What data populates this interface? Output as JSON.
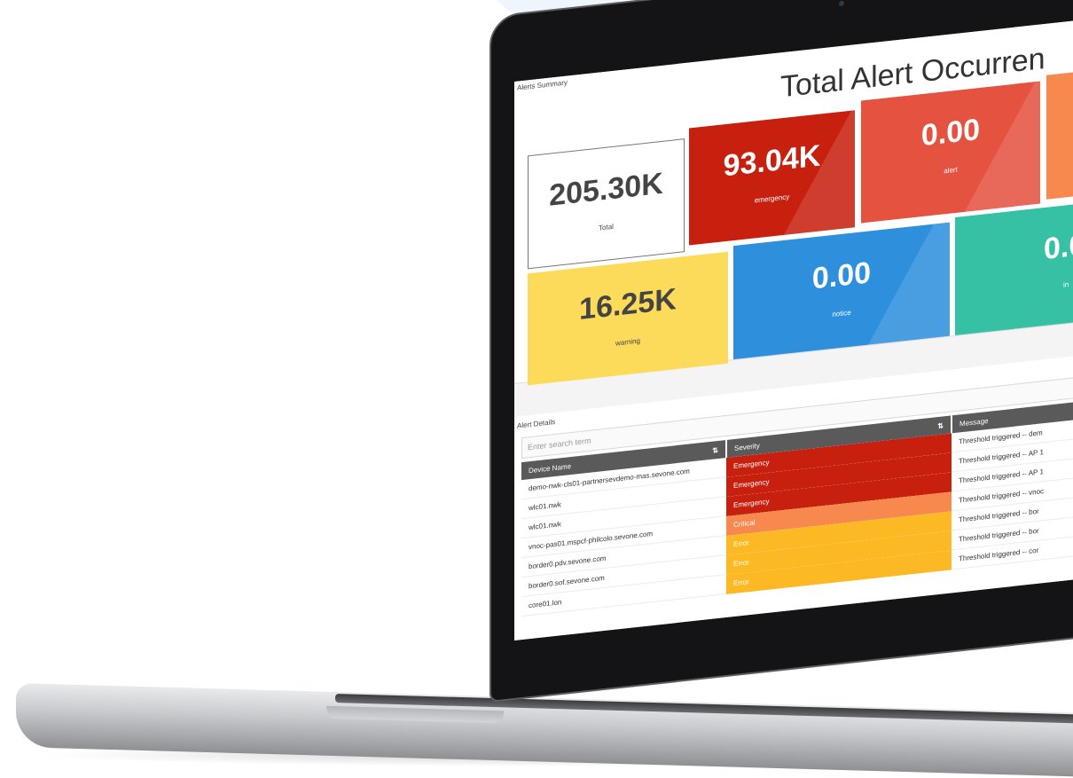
{
  "colors": {
    "total": "#ffffff",
    "emergency": "#c8200f",
    "alert": "#e55240",
    "critical_tile": "#f7884e",
    "warning": "#fddb5a",
    "notice": "#2e8fdd",
    "info": "#36c1a5",
    "sev_emergency": "#c8200f",
    "sev_critical": "#f7884e",
    "sev_error": "#fcb923"
  },
  "summary": {
    "panel_title": "Alerts Summary",
    "title": "Total Alert Occurren",
    "tiles": [
      {
        "value": "205.30K",
        "label": "Total"
      },
      {
        "value": "93.04K",
        "label": "emergency"
      },
      {
        "value": "0.00",
        "label": "alert"
      },
      {
        "value": "",
        "label": ""
      },
      {
        "value": "16.25K",
        "label": "warning"
      },
      {
        "value": "0.00",
        "label": "notice"
      },
      {
        "value": "0.0",
        "label": "in"
      }
    ]
  },
  "details": {
    "panel_title": "Alert Details",
    "search_placeholder": "Enter search term",
    "columns": [
      "Device Name",
      "Severity",
      "Message"
    ],
    "sort_icon": "⇅",
    "rows": [
      {
        "device": "demo-nwk-cls01-partnersevdemo-mas.sevone.com",
        "severity": "Emergency",
        "message": "Threshold triggered -- dem"
      },
      {
        "device": "wlc01.nwk",
        "severity": "Emergency",
        "message": "Threshold triggered -- AP 1"
      },
      {
        "device": "wlc01.nwk",
        "severity": "Emergency",
        "message": "Threshold triggered -- AP 1"
      },
      {
        "device": "vnoc-pas01.mspcf-philcolo.sevone.com",
        "severity": "Critical",
        "message": "Threshold triggered -- vnoc"
      },
      {
        "device": "border0.pdv.sevone.com",
        "severity": "Error",
        "message": "Threshold triggered -- bor"
      },
      {
        "device": "border0.sof.sevone.com",
        "severity": "Error",
        "message": "Threshold triggered -- bor"
      },
      {
        "device": "core01.lon",
        "severity": "Error",
        "message": "Threshold triggered -- cor"
      }
    ]
  }
}
